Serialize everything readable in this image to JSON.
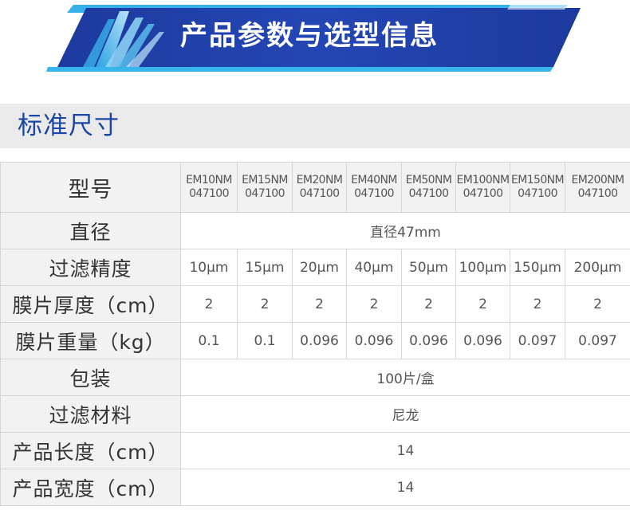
{
  "banner": {
    "title": "产品参数与选型信息"
  },
  "section": {
    "title": "标准尺寸"
  },
  "table": {
    "model_label": "型号",
    "models": [
      {
        "name": "EM10NM",
        "code": "047100"
      },
      {
        "name": "EM15NM",
        "code": "047100"
      },
      {
        "name": "EM20NM",
        "code": "047100"
      },
      {
        "name": "EM40NM",
        "code": "047100"
      },
      {
        "name": "EM50NM",
        "code": "047100"
      },
      {
        "name": "EM100NM",
        "code": "047100"
      },
      {
        "name": "EM150NM",
        "code": "047100"
      },
      {
        "name": "EM200NM",
        "code": "047100"
      }
    ],
    "diameter": {
      "label": "直径",
      "value": "直径47mm"
    },
    "precision": {
      "label": "过滤精度",
      "values": [
        "10μm",
        "15μm",
        "20μm",
        "40μm",
        "50μm",
        "100μm",
        "150μm",
        "200μm"
      ]
    },
    "thickness": {
      "label": "膜片厚度（cm）",
      "values": [
        "2",
        "2",
        "2",
        "2",
        "2",
        "2",
        "2",
        "2"
      ]
    },
    "weight": {
      "label": "膜片重量（kg）",
      "values": [
        "0.1",
        "0.1",
        "0.096",
        "0.096",
        "0.096",
        "0.096",
        "0.097",
        "0.097"
      ]
    },
    "package": {
      "label": "包装",
      "value": "100片/盒"
    },
    "material": {
      "label": "过滤材料",
      "value": "尼龙"
    },
    "length": {
      "label": "产品长度（cm）",
      "value": "14"
    },
    "width": {
      "label": "产品宽度（cm）",
      "value": "14"
    }
  },
  "colors": {
    "banner_blue": "#1f3fa8",
    "banner_light": "#3ab2e8",
    "section_title": "#1a46a3",
    "header_bg": "#eaeaea",
    "label_bg": "#f2f2f2",
    "border": "#d6d6d6"
  }
}
